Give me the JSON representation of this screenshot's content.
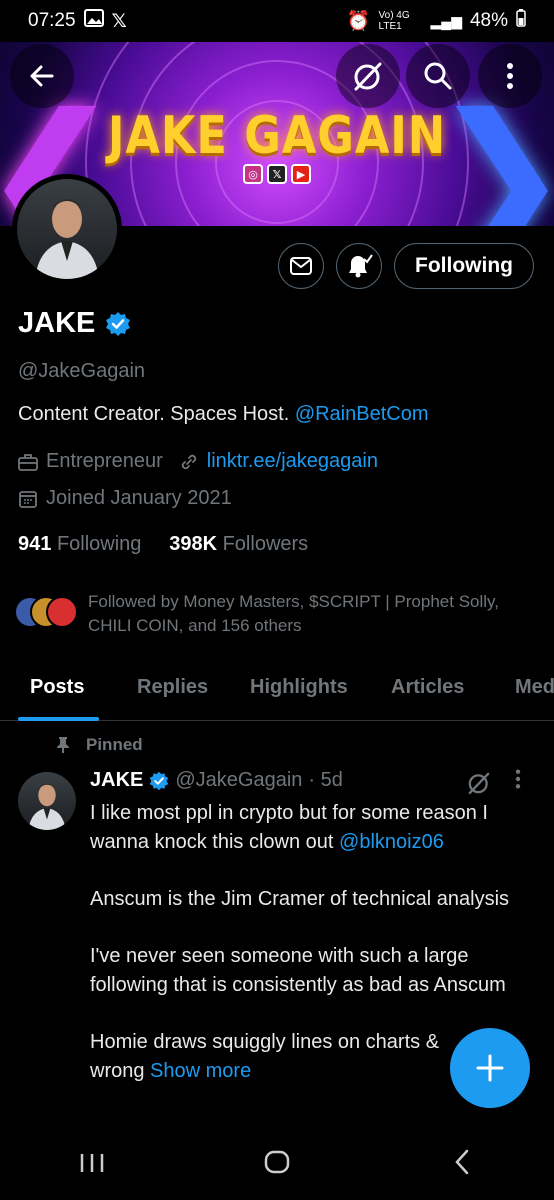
{
  "status_bar": {
    "time": "07:25",
    "network": "Vo) 4G LTE1",
    "battery": "48%"
  },
  "banner": {
    "title": "JAKE GAGAIN"
  },
  "header_icons": {
    "back": "arrow-left-icon",
    "grok": "grok-icon",
    "search": "search-icon",
    "more": "more-vertical-icon"
  },
  "profile": {
    "name": "JAKE",
    "verified": true,
    "handle": "@JakeGagain",
    "bio_text": "Content Creator. Spaces Host.",
    "bio_link": "@RainBetCom",
    "occupation": "Entrepreneur",
    "website": "linktr.ee/jakegagain",
    "joined": "Joined January 2021",
    "following_count": "941",
    "following_label": "Following",
    "followers_count": "398K",
    "followers_label": "Followers",
    "followed_by": "Followed by Money Masters, $SCRIPT | Prophet Solly, CHILI COIN, and 156 others"
  },
  "actions": {
    "follow_label": "Following"
  },
  "tabs": [
    {
      "label": "Posts"
    },
    {
      "label": "Replies"
    },
    {
      "label": "Highlights"
    },
    {
      "label": "Articles"
    },
    {
      "label": "Med"
    }
  ],
  "post": {
    "pinned_label": "Pinned",
    "author_name": "JAKE",
    "author_handle": "@JakeGagain",
    "time": "· 5d",
    "line1_text": "I like most ppl in crypto but for some reason I wanna knock this clown out",
    "line1_mention": "@blknoiz06",
    "para2": "Anscum is the Jim Cramer of technical analysis",
    "para3": "I've never seen someone with such a large following that is consistently as bad as Anscum",
    "para4": "Homie draws squiggly lines on charts &",
    "para4_cut": "wrong",
    "show_more": "Show more"
  },
  "colors": {
    "accent": "#1d9bf0",
    "muted": "#71767b",
    "banner_title": "#ffcf2e"
  }
}
